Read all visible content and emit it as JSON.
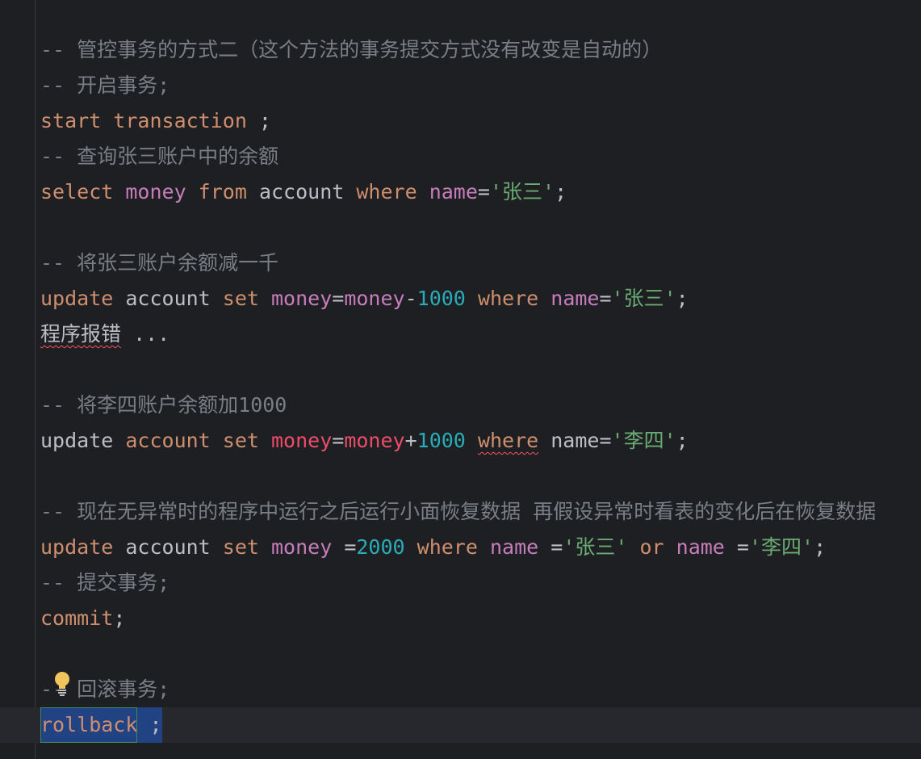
{
  "editor": {
    "lines": [
      {
        "id": "l1",
        "tokens": [
          {
            "c": "cmt",
            "t": "-- 管控事务的方式二（这个方法的事务提交方式没有改变是自动的）"
          }
        ]
      },
      {
        "id": "l2",
        "tokens": [
          {
            "c": "cmt",
            "t": "-- 开启事务;"
          }
        ]
      },
      {
        "id": "l3",
        "tokens": [
          {
            "c": "kw",
            "t": "start transaction"
          },
          {
            "c": "plain",
            "t": " ;"
          }
        ]
      },
      {
        "id": "l4",
        "tokens": [
          {
            "c": "cmt",
            "t": "-- 查询张三账户中的余额"
          }
        ]
      },
      {
        "id": "l5",
        "tokens": [
          {
            "c": "kw",
            "t": "select "
          },
          {
            "c": "col",
            "t": "money"
          },
          {
            "c": "kw",
            "t": " from"
          },
          {
            "c": "plain",
            "t": " account "
          },
          {
            "c": "kw",
            "t": "where"
          },
          {
            "c": "plain",
            "t": " "
          },
          {
            "c": "col",
            "t": "name"
          },
          {
            "c": "plain",
            "t": "="
          },
          {
            "c": "str",
            "t": "'张三'"
          },
          {
            "c": "plain",
            "t": ";"
          }
        ]
      },
      {
        "id": "l6",
        "tokens": []
      },
      {
        "id": "l7",
        "tokens": [
          {
            "c": "cmt",
            "t": "-- 将张三账户余额减一千"
          }
        ]
      },
      {
        "id": "l8",
        "tokens": [
          {
            "c": "kw",
            "t": "update"
          },
          {
            "c": "plain",
            "t": " account "
          },
          {
            "c": "kw",
            "t": "set"
          },
          {
            "c": "plain",
            "t": " "
          },
          {
            "c": "col",
            "t": "money"
          },
          {
            "c": "plain",
            "t": "="
          },
          {
            "c": "col",
            "t": "money"
          },
          {
            "c": "plain",
            "t": "-"
          },
          {
            "c": "num",
            "t": "1000"
          },
          {
            "c": "plain",
            "t": " "
          },
          {
            "c": "kw",
            "t": "where"
          },
          {
            "c": "plain",
            "t": " "
          },
          {
            "c": "col",
            "t": "name"
          },
          {
            "c": "plain",
            "t": "="
          },
          {
            "c": "str",
            "t": "'张三'"
          },
          {
            "c": "plain",
            "t": ";"
          }
        ]
      },
      {
        "id": "l9",
        "tokens": [
          {
            "c": "plain squiggle",
            "t": "程序报错"
          },
          {
            "c": "plain",
            "t": " ..."
          }
        ]
      },
      {
        "id": "l10",
        "tokens": []
      },
      {
        "id": "l11",
        "tokens": [
          {
            "c": "cmt",
            "t": "-- 将李四账户余额加1000"
          }
        ]
      },
      {
        "id": "l12",
        "tokens": [
          {
            "c": "plain",
            "t": "update "
          },
          {
            "c": "kw",
            "t": "account"
          },
          {
            "c": "plain",
            "t": " "
          },
          {
            "c": "kw",
            "t": "set"
          },
          {
            "c": "plain",
            "t": " "
          },
          {
            "c": "col2",
            "t": "money"
          },
          {
            "c": "plain",
            "t": "="
          },
          {
            "c": "col2",
            "t": "money"
          },
          {
            "c": "plain",
            "t": "+"
          },
          {
            "c": "num",
            "t": "1000"
          },
          {
            "c": "plain",
            "t": " "
          },
          {
            "c": "kw squiggle",
            "t": "where"
          },
          {
            "c": "plain",
            "t": " name="
          },
          {
            "c": "str",
            "t": "'李四'"
          },
          {
            "c": "plain",
            "t": ";"
          }
        ]
      },
      {
        "id": "l13",
        "tokens": []
      },
      {
        "id": "l14",
        "tokens": [
          {
            "c": "cmt",
            "t": "-- 现在无异常时的程序中运行之后运行小面恢复数据 再假设异常时看表的变化后在恢复数据"
          }
        ]
      },
      {
        "id": "l15",
        "tokens": [
          {
            "c": "kw",
            "t": "update"
          },
          {
            "c": "plain",
            "t": " account "
          },
          {
            "c": "kw",
            "t": "set"
          },
          {
            "c": "plain",
            "t": " "
          },
          {
            "c": "col",
            "t": "money"
          },
          {
            "c": "plain",
            "t": " ="
          },
          {
            "c": "num",
            "t": "2000"
          },
          {
            "c": "plain",
            "t": " "
          },
          {
            "c": "kw",
            "t": "where"
          },
          {
            "c": "plain",
            "t": " "
          },
          {
            "c": "col",
            "t": "name"
          },
          {
            "c": "plain",
            "t": " ="
          },
          {
            "c": "str",
            "t": "'张三'"
          },
          {
            "c": "plain",
            "t": " "
          },
          {
            "c": "kw",
            "t": "or"
          },
          {
            "c": "plain",
            "t": " "
          },
          {
            "c": "col",
            "t": "name"
          },
          {
            "c": "plain",
            "t": " ="
          },
          {
            "c": "str",
            "t": "'李四'"
          },
          {
            "c": "plain",
            "t": ";"
          }
        ]
      },
      {
        "id": "l16",
        "tokens": [
          {
            "c": "cmt",
            "t": "-- 提交事务;"
          }
        ]
      },
      {
        "id": "l17",
        "tokens": [
          {
            "c": "kw",
            "t": "commit"
          },
          {
            "c": "plain",
            "t": ";"
          }
        ]
      },
      {
        "id": "l18",
        "tokens": []
      },
      {
        "id": "l19",
        "tokens": [
          {
            "c": "cmt",
            "t": "-- 回滚事务;"
          }
        ]
      }
    ],
    "last_line": {
      "word": "rollback",
      "rest": " ;"
    }
  },
  "icons": {
    "intention": "lightbulb-icon",
    "run_status": "checkmark-icon"
  },
  "colors": {
    "background": "#1e1f22",
    "keyword": "#cf8e6d",
    "column": "#c77dbb",
    "number": "#2aacb8",
    "string": "#6aab73",
    "comment": "#7a7e85",
    "selection": "#214283"
  }
}
